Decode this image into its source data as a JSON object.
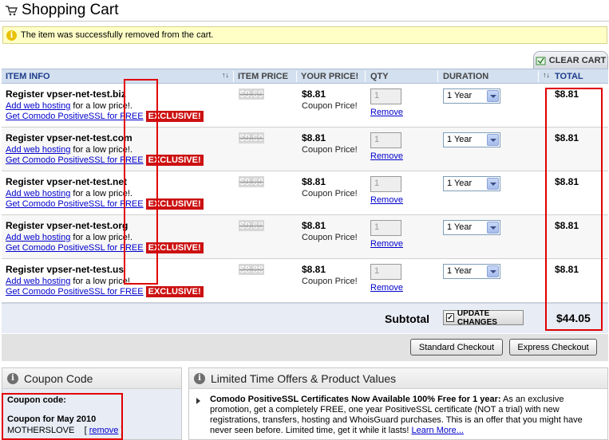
{
  "page": {
    "title": "Shopping Cart",
    "notice": "The item was successfully removed from the cart.",
    "clear_cart": "CLEAR CART"
  },
  "table": {
    "headers": {
      "item_info": "ITEM INFO",
      "item_price": "ITEM PRICE",
      "your_price": "YOUR PRICE!",
      "qty": "QTY",
      "duration": "DURATION",
      "total": "TOTAL",
      "sort_glyph": "↑↓"
    },
    "rows": [
      {
        "name": "Register vpser-net-test.biz",
        "old_price": "$9.69",
        "your_price": "$8.81",
        "coupon": "Coupon Price!",
        "qty": "1",
        "duration": "1 Year",
        "total": "$8.81"
      },
      {
        "name": "Register vpser-net-test.com",
        "old_price": "$9.69",
        "your_price": "$8.81",
        "coupon": "Coupon Price!",
        "qty": "1",
        "duration": "1 Year",
        "total": "$8.81"
      },
      {
        "name": "Register vpser-net-test.net",
        "old_price": "$9.69",
        "your_price": "$8.81",
        "coupon": "Coupon Price!",
        "qty": "1",
        "duration": "1 Year",
        "total": "$8.81"
      },
      {
        "name": "Register vpser-net-test.org",
        "old_price": "$9.69",
        "your_price": "$8.81",
        "coupon": "Coupon Price!",
        "qty": "1",
        "duration": "1 Year",
        "total": "$8.81"
      },
      {
        "name": "Register vpser-net-test.us",
        "old_price": "$8.88",
        "your_price": "$8.81",
        "coupon": "Coupon Price!",
        "qty": "1",
        "duration": "1 Year",
        "total": "$8.81"
      }
    ],
    "row_links": {
      "add_hosting": "Add web hosting",
      "low_price": " for a low price!.",
      "comodo": "Get Comodo PositiveSSL for FREE",
      "exclusive": "EXCLUSIVE!",
      "remove": "Remove"
    },
    "subtotal_label": "Subtotal",
    "update_changes": "UPDATE CHANGES",
    "subtotal_value": "$44.05"
  },
  "checkout": {
    "standard": "Standard Checkout",
    "express": "Express Checkout"
  },
  "coupon_box": {
    "title": "Coupon Code",
    "label": "Coupon code:",
    "name": "Coupon for May 2010",
    "code": "MOTHERSLOVE",
    "remove_open": "[",
    "remove": "remove",
    "remove_close": "]"
  },
  "offers_box": {
    "title": "Limited Time Offers & Product Values",
    "headline": "Comodo PositiveSSL Certificates Now Available 100% Free for 1 year:",
    "body": " As an exclusive promotion, get a completely FREE, one year PositiveSSL certificate (NOT a trial) with new registrations, transfers, hosting and WhoisGuard purchases. This is an offer that you might have never seen before. Limited time, get it while it lasts! ",
    "learn_more": "Learn More..."
  },
  "colors": {
    "accent_red": "#cc1111",
    "header_blue": "#d3e0ef",
    "notice_yellow": "#ffffc6",
    "annotation_red": "#e00000"
  }
}
